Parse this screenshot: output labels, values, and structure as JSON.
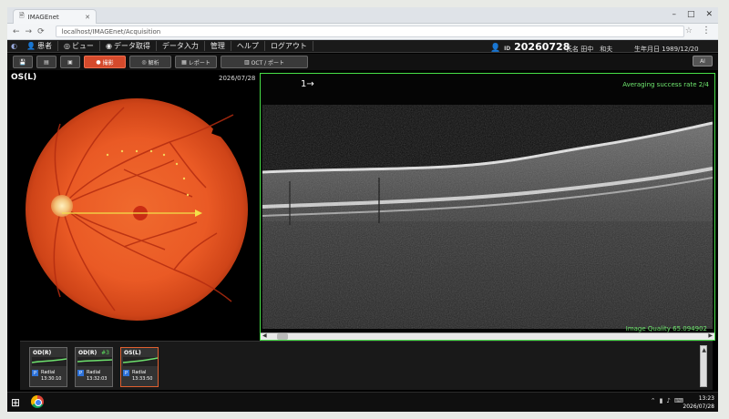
{
  "browser": {
    "tab_title": "IMAGEnet",
    "url": "localhost/IMAGEnet/Acquisition"
  },
  "menu": [
    "患者",
    "ビュー",
    "データ取得",
    "データ入力",
    "管理",
    "ヘルプ",
    "ログアウト"
  ],
  "patient": {
    "id_label": "ID",
    "id": "20260728",
    "name_label": "氏名",
    "name": "田中　和夫",
    "dob_label": "生年月日",
    "dob": "1989/12/20"
  },
  "toolbar": {
    "capture": "撮影",
    "analysis": "解析",
    "report": "レポート",
    "oct_mode": "OCT / ポート",
    "right_btn": "AI"
  },
  "fundus": {
    "eye": "OS(L)",
    "date": "2026/07/28"
  },
  "oct": {
    "arrow": "1→",
    "averaging": "Averaging success rate 2/4",
    "quality": "Image Quality 65.094902"
  },
  "thumbnails": [
    {
      "eye": "OD(R)",
      "num": "",
      "scan": "Radial",
      "time": "13:30:10"
    },
    {
      "eye": "OD(R)",
      "num": "#3",
      "scan": "Radial",
      "time": "13:32:03"
    },
    {
      "eye": "OS(L)",
      "num": "",
      "scan": "Radial",
      "time": "13:33:50"
    }
  ],
  "taskbar": {
    "time": "13:23",
    "date": "2026/07/28"
  }
}
